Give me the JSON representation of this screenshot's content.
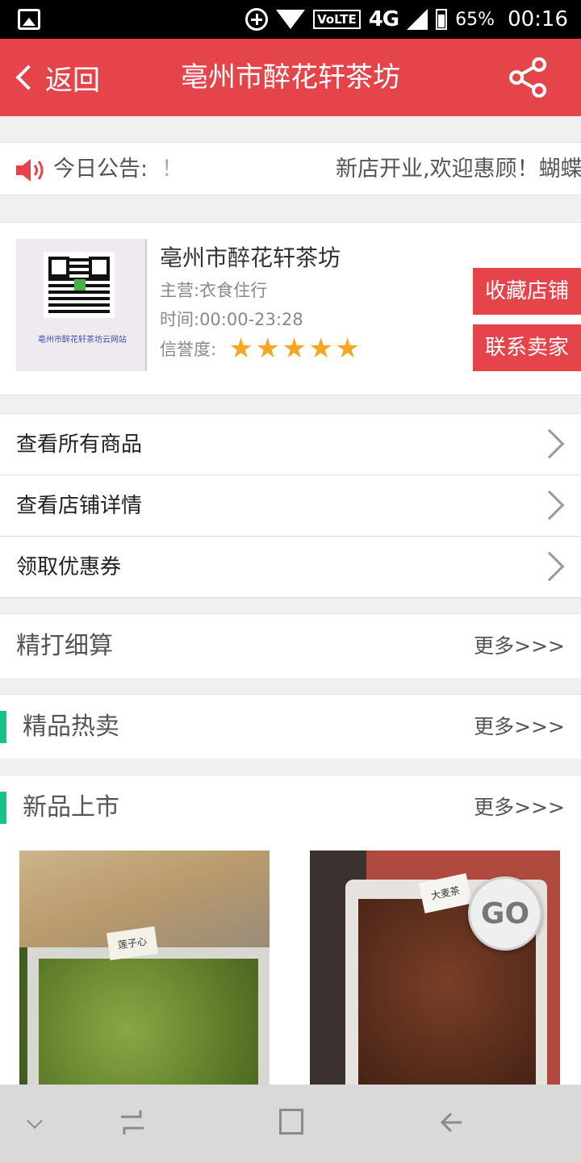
{
  "status_bar": {
    "network_badge": "VoLTE",
    "network_type": "4G",
    "battery": "65%",
    "time": "00:16"
  },
  "header": {
    "back_label": "返回",
    "title": "亳州市醉花轩茶坊"
  },
  "notice": {
    "label": "今日公告:",
    "label_tail": "！",
    "text": "新店开业,欢迎惠顾！蝴蝶"
  },
  "shop": {
    "logo_caption": "亳州市醉花轩茶坊云网站",
    "name": "亳州市醉花轩茶坊",
    "main_business": "主营:衣食住行",
    "hours": "时间:00:00-23:28",
    "credit_label": "信誉度:",
    "rating_stars": 5,
    "favorite_button": "收藏店铺",
    "contact_button": "联系卖家"
  },
  "menu": {
    "items": [
      {
        "label": "查看所有商品"
      },
      {
        "label": "查看店铺详情"
      },
      {
        "label": "领取优惠券"
      }
    ]
  },
  "sections": {
    "deals": {
      "title": "精打细算",
      "more": "更多>>>"
    },
    "hot": {
      "title": "精品热卖",
      "more": "更多>>>"
    },
    "new": {
      "title": "新品上市",
      "more": "更多>>>"
    }
  },
  "products": [
    {
      "tag": "莲子心"
    },
    {
      "tag": "大麦茶"
    }
  ],
  "go_button": "GO",
  "colors": {
    "brand_red": "#e4444a",
    "accent_green": "#19c28a",
    "star_gold": "#f5a623"
  }
}
